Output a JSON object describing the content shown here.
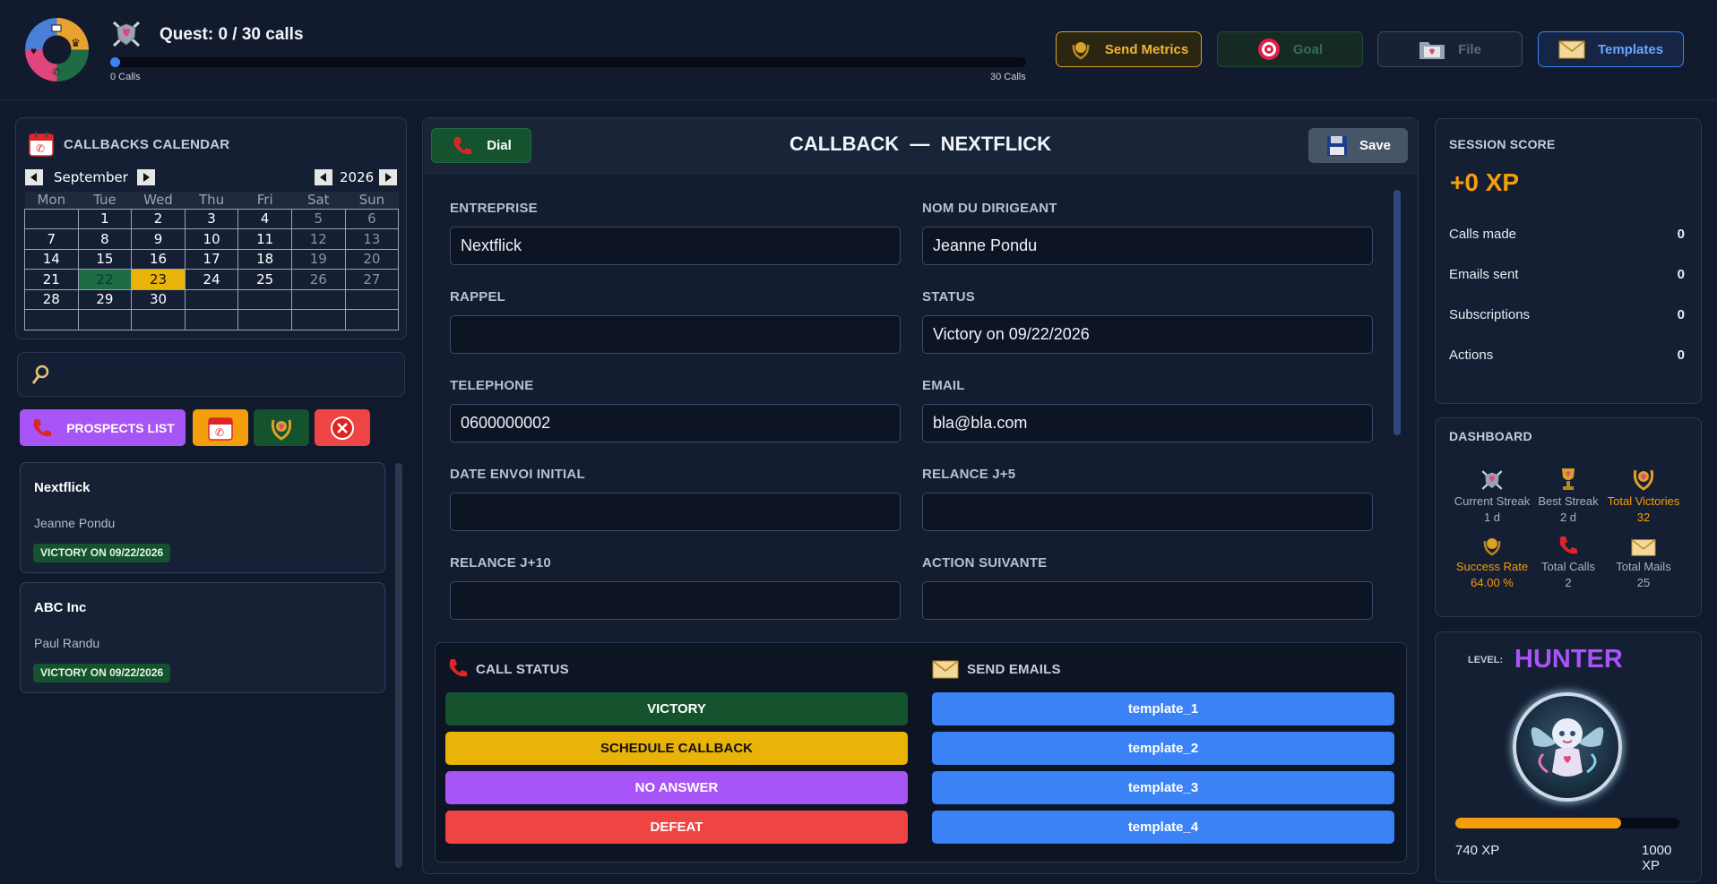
{
  "quest": {
    "title": "Quest: 0 / 30 calls",
    "current": 0,
    "total": 30,
    "progress_fraction": 0,
    "left_label": "0 Calls",
    "right_label": "30 Calls"
  },
  "top_buttons": {
    "send_metrics": "Send Metrics",
    "goal": "Goal",
    "file": "File",
    "templates": "Templates"
  },
  "calendar": {
    "title": "CALLBACKS CALENDAR",
    "month": "September",
    "year": "2026",
    "weekdays": [
      "Mon",
      "Tue",
      "Wed",
      "Thu",
      "Fri",
      "Sat",
      "Sun"
    ],
    "weeks": [
      [
        "",
        "1",
        "2",
        "3",
        "4",
        "5",
        "6"
      ],
      [
        "7",
        "8",
        "9",
        "10",
        "11",
        "12",
        "13"
      ],
      [
        "14",
        "15",
        "16",
        "17",
        "18",
        "19",
        "20"
      ],
      [
        "21",
        "22",
        "23",
        "24",
        "25",
        "26",
        "27"
      ],
      [
        "28",
        "29",
        "30",
        "",
        "",
        "",
        ""
      ],
      [
        "",
        "",
        "",
        "",
        "",
        "",
        ""
      ]
    ],
    "highlight_green": "22",
    "highlight_yellow": "23"
  },
  "search": {
    "placeholder": ""
  },
  "left_buttons": {
    "prospects_list": "PROSPECTS LIST"
  },
  "prospects": [
    {
      "company": "Nextflick",
      "contact": "Jeanne Pondu",
      "badge": "VICTORY ON 09/22/2026"
    },
    {
      "company": "ABC Inc",
      "contact": "Paul Randu",
      "badge": "VICTORY ON 09/22/2026"
    }
  ],
  "header": {
    "dial": "Dial",
    "title": "CALLBACK  —  NEXTFLICK",
    "save": "Save"
  },
  "form": {
    "entreprise": {
      "label": "ENTREPRISE",
      "value": "Nextflick"
    },
    "dirigeant": {
      "label": "NOM DU DIRIGEANT",
      "value": "Jeanne Pondu"
    },
    "rappel": {
      "label": "RAPPEL",
      "value": ""
    },
    "status": {
      "label": "STATUS",
      "value": "Victory on 09/22/2026"
    },
    "telephone": {
      "label": "TELEPHONE",
      "value": "0600000002"
    },
    "email": {
      "label": "EMAIL",
      "value": "bla@bla.com"
    },
    "date_envoi": {
      "label": "DATE ENVOI INITIAL",
      "value": ""
    },
    "relance5": {
      "label": "RELANCE J+5",
      "value": ""
    },
    "relance10": {
      "label": "RELANCE J+10",
      "value": ""
    },
    "action": {
      "label": "ACTION SUIVANTE",
      "value": ""
    }
  },
  "call_status": {
    "title": "CALL STATUS",
    "victory": "VICTORY",
    "schedule": "SCHEDULE CALLBACK",
    "no_answer": "NO ANSWER",
    "defeat": "DEFEAT"
  },
  "send_emails": {
    "title": "SEND EMAILS",
    "templates": [
      "template_1",
      "template_2",
      "template_3",
      "template_4"
    ]
  },
  "session": {
    "title": "SESSION SCORE",
    "xp": "+0 XP",
    "rows": [
      {
        "label": "Calls made",
        "value": "0"
      },
      {
        "label": "Emails sent",
        "value": "0"
      },
      {
        "label": "Subscriptions",
        "value": "0"
      },
      {
        "label": "Actions",
        "value": "0"
      }
    ]
  },
  "dashboard": {
    "title": "DASHBOARD",
    "items": [
      {
        "label": "Current Streak",
        "value": "1 d"
      },
      {
        "label": "Best Streak",
        "value": "2 d"
      },
      {
        "label": "Total Victories",
        "value": "32"
      },
      {
        "label": "Success Rate",
        "value": "64.00 %"
      },
      {
        "label": "Total Calls",
        "value": "2"
      },
      {
        "label": "Total Mails",
        "value": "25"
      }
    ]
  },
  "level": {
    "label": "LEVEL:",
    "name": "HUNTER",
    "xp_current": 740,
    "xp_max": 1000,
    "xp_left_label": "740 XP",
    "xp_right_label": "1000 XP"
  },
  "colors": {
    "accent_blue": "#3b82f6",
    "victory_green": "#14532d",
    "schedule_yellow": "#eab308",
    "no_answer_purple": "#a855f7",
    "defeat_red": "#ef4444",
    "xp_orange": "#f59e0b",
    "level_purple": "#a855f7"
  }
}
